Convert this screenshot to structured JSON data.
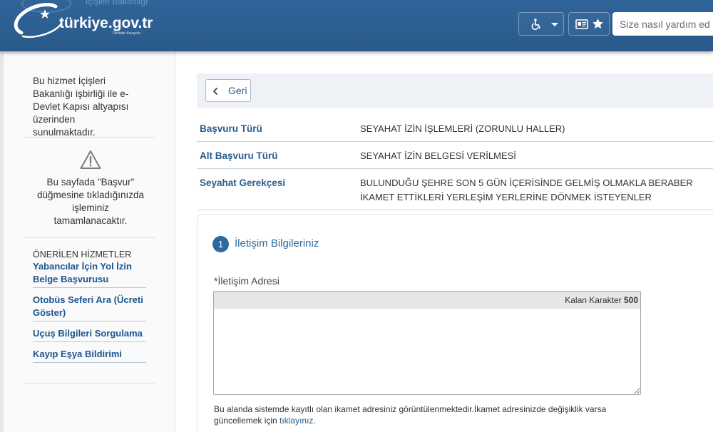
{
  "header": {
    "ghost_text": "İçişleri Bakanlığı",
    "logo": {
      "text": "türkiye.gov.tr",
      "tagline": "Devletin Kısayolu",
      "icon": "turkiye-gov-logo-icon"
    },
    "accessibility_button": {
      "icon": "wheelchair-icon",
      "dropdown_icon": "chevron-down-icon"
    },
    "favorites_button": {
      "icons": [
        "id-card-icon",
        "star-icon"
      ]
    },
    "search": {
      "placeholder": "Size nasıl yardım ed",
      "value": ""
    }
  },
  "sidebar": {
    "intro": "Bu hizmet İçişleri Bakanlığı işbirliği ile e-Devlet Kapısı altyapısı üzerinden sunulmaktadır.",
    "warning": {
      "icon": "warning-icon",
      "text": "Bu sayfada \"Başvur\" düğmesine tıkladığınızda işleminiz tamamlanacaktır."
    },
    "recommended": {
      "title": "ÖNERİLEN HİZMETLER",
      "links": [
        "Yabancılar İçin Yol İzin Belge Başvurusu",
        "Otobüs Seferi Ara (Ücreti Göster)",
        "Uçuş Bilgileri Sorgulama",
        "Kayıp Eşya Bildirimi"
      ]
    }
  },
  "main": {
    "back_button": {
      "label": "Geri",
      "icon": "chevron-left-icon"
    },
    "details": [
      {
        "label": "Başvuru Türü",
        "value": "SEYAHAT İZİN İŞLEMLERİ (ZORUNLU HALLER)"
      },
      {
        "label": "Alt Başvuru Türü",
        "value": "SEYAHAT İZİN BELGESİ VERİLMESİ"
      },
      {
        "label": "Seyahat Gerekçesi",
        "value": "BULUNDUĞU ŞEHRE SON 5 GÜN İÇERİSİNDE GELMİŞ OLMAKLA BERABER İKAMET ETTİKLERİ YERLEŞİM YERLERİNE DÖNMEK İSTEYENLER"
      }
    ],
    "step": {
      "number": "1",
      "title": "İletişim Bilgileriniz"
    },
    "address_field": {
      "label": "*İletişim Adresi",
      "value": "",
      "counter_label": "Kalan Karakter",
      "counter_value": "500"
    },
    "help": {
      "text": "Bu alanda sistemde kayıtlı olan ikamet adresiniz görüntülenmektedir.İkamet adresinizde değişiklik varsa güncellemek için",
      "link": "tıklayınız",
      "suffix": "."
    }
  },
  "colors": {
    "header": "#2c5f8e",
    "label_blue": "#285d8f",
    "link_blue": "#1b5591",
    "step_circle": "#2b69a0",
    "back_bar": "#eef1f5"
  }
}
